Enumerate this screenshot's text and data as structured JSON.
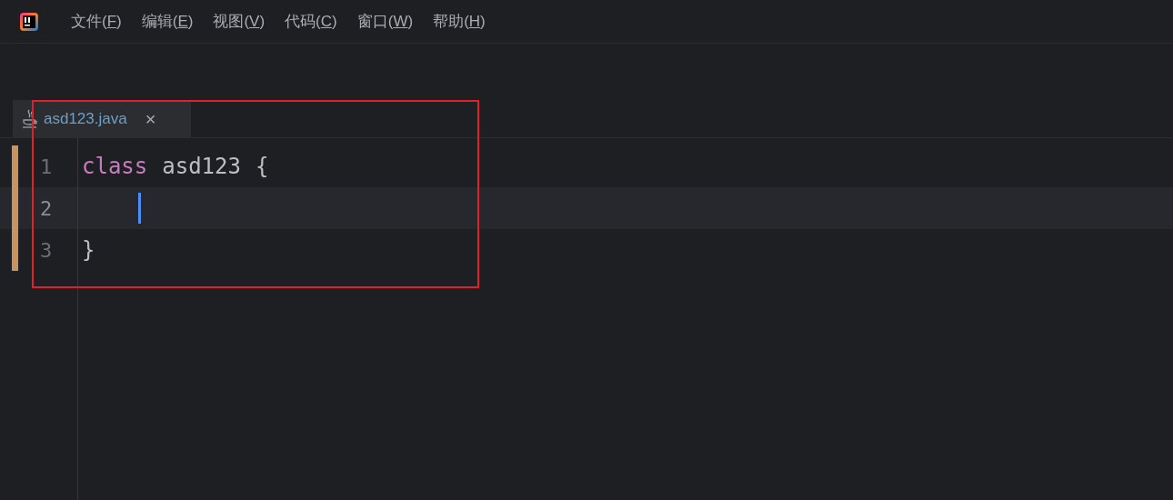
{
  "menu": [
    {
      "prefix": "文件(",
      "key": "F",
      "suffix": ")"
    },
    {
      "prefix": "编辑(",
      "key": "E",
      "suffix": ")"
    },
    {
      "prefix": "视图(",
      "key": "V",
      "suffix": ")"
    },
    {
      "prefix": "代码(",
      "key": "C",
      "suffix": ")"
    },
    {
      "prefix": "窗口(",
      "key": "W",
      "suffix": ")"
    },
    {
      "prefix": "帮助(",
      "key": "H",
      "suffix": ")"
    }
  ],
  "tabs": [
    {
      "label": "asd123.java",
      "close": "×",
      "selected": true
    }
  ],
  "editor": {
    "lines": [
      {
        "number": "1",
        "current": false,
        "modified": true,
        "caret": false,
        "tokens": [
          {
            "kind": "keyword",
            "text": "class"
          },
          {
            "kind": "plain",
            "text": "asd123"
          },
          {
            "kind": "plain",
            "text": "{"
          }
        ]
      },
      {
        "number": "2",
        "current": true,
        "modified": true,
        "caret": true
      },
      {
        "number": "3",
        "current": false,
        "modified": true,
        "caret": false,
        "tokens": [
          {
            "kind": "plain",
            "text": "}"
          }
        ]
      }
    ]
  },
  "annotation": {
    "kind": "highlight-box",
    "color": "#e0202a"
  }
}
